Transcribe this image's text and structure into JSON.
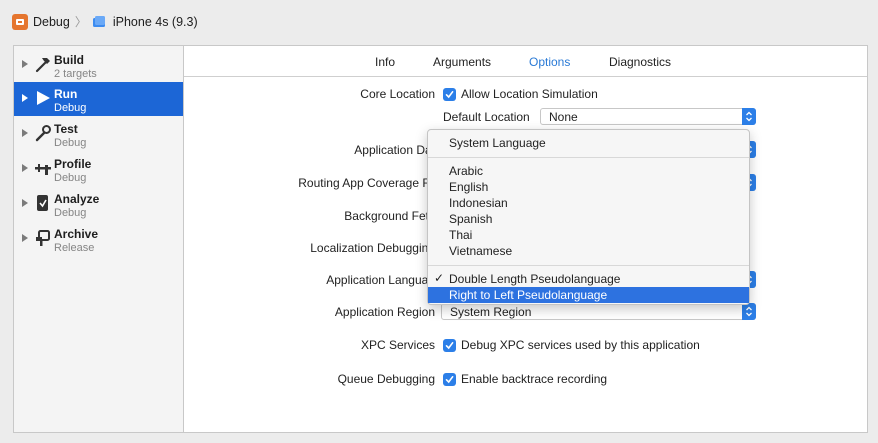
{
  "toolbar": {
    "scheme_name": "Debug",
    "device_name": "iPhone 4s (9.3)"
  },
  "sidebar": {
    "items": [
      {
        "title": "Build",
        "subtitle": "2 targets",
        "icon": "hammer-icon",
        "selected": false
      },
      {
        "title": "Run",
        "subtitle": "Debug",
        "icon": "play-icon",
        "selected": true
      },
      {
        "title": "Test",
        "subtitle": "Debug",
        "icon": "wrench-icon",
        "selected": false
      },
      {
        "title": "Profile",
        "subtitle": "Debug",
        "icon": "gauge-icon",
        "selected": false
      },
      {
        "title": "Analyze",
        "subtitle": "Debug",
        "icon": "analyze-icon",
        "selected": false
      },
      {
        "title": "Archive",
        "subtitle": "Release",
        "icon": "archive-icon",
        "selected": false
      }
    ]
  },
  "tabs": [
    {
      "label": "Info",
      "active": false
    },
    {
      "label": "Arguments",
      "active": false
    },
    {
      "label": "Options",
      "active": true
    },
    {
      "label": "Diagnostics",
      "active": false
    }
  ],
  "options": {
    "core_location_label": "Core Location",
    "allow_location_label": "Allow Location Simulation",
    "default_location_label": "Default Location",
    "default_location_value": "None",
    "app_data_label": "Application Dat",
    "routing_label": "Routing App Coverage Fil",
    "background_fetch_label": "Background Fetc",
    "localization_label": "Localization Debugging",
    "app_language_label": "Application Languag",
    "app_region_label": "Application Region",
    "app_region_value": "System Region",
    "xpc_label": "XPC Services",
    "xpc_checkbox_label": "Debug XPC services used by this application",
    "queue_label": "Queue Debugging",
    "queue_checkbox_label": "Enable backtrace recording"
  },
  "language_menu": {
    "system": "System Language",
    "languages": [
      "Arabic",
      "English",
      "Indonesian",
      "Spanish",
      "Thai",
      "Vietnamese"
    ],
    "pseudo": [
      {
        "label": "Double Length Pseudolanguage",
        "checked": true,
        "highlighted": false
      },
      {
        "label": "Right to Left Pseudolanguage",
        "checked": false,
        "highlighted": true
      }
    ],
    "check_glyph": "✓"
  },
  "colors": {
    "selection_blue": "#1c66d6",
    "accent_blue": "#2c7fe8",
    "menu_highlight": "#2d72e0",
    "scheme_orange": "#e5752e"
  }
}
